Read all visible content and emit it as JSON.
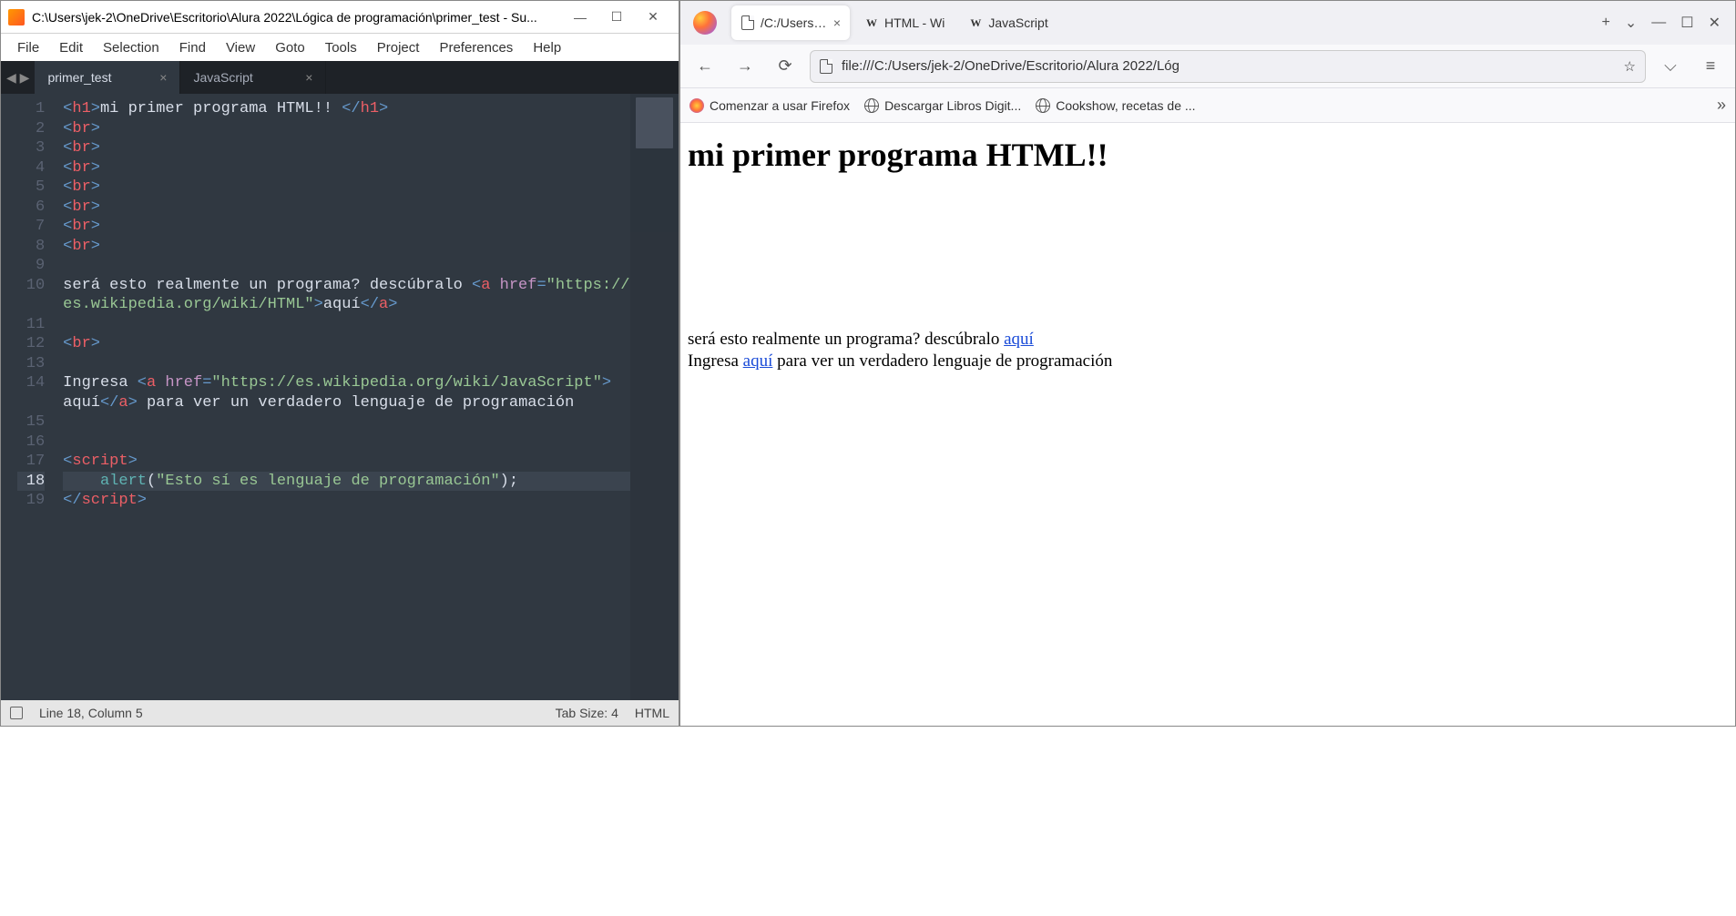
{
  "sublime": {
    "title": "C:\\Users\\jek-2\\OneDrive\\Escritorio\\Alura 2022\\Lógica de programación\\primer_test - Su...",
    "menu": [
      "File",
      "Edit",
      "Selection",
      "Find",
      "View",
      "Goto",
      "Tools",
      "Project",
      "Preferences",
      "Help"
    ],
    "tabs": [
      {
        "label": "primer_test",
        "active": true
      },
      {
        "label": "JavaScript",
        "active": false
      }
    ],
    "gutter": [
      "1",
      "2",
      "3",
      "4",
      "5",
      "6",
      "7",
      "8",
      "9",
      "10",
      "",
      "11",
      "12",
      "13",
      "14",
      "",
      "15",
      "16",
      "17",
      "18",
      "19"
    ],
    "code_lines": [
      {
        "hl": false,
        "segs": [
          {
            "c": "brkt",
            "t": "<"
          },
          {
            "c": "tag",
            "t": "h1"
          },
          {
            "c": "brkt",
            "t": ">"
          },
          {
            "c": "txt",
            "t": "mi primer programa HTML!! "
          },
          {
            "c": "brkt",
            "t": "</"
          },
          {
            "c": "tag",
            "t": "h1"
          },
          {
            "c": "brkt",
            "t": ">"
          }
        ]
      },
      {
        "hl": false,
        "segs": [
          {
            "c": "brkt",
            "t": "<"
          },
          {
            "c": "tag",
            "t": "br"
          },
          {
            "c": "brkt",
            "t": ">"
          }
        ]
      },
      {
        "hl": false,
        "segs": [
          {
            "c": "brkt",
            "t": "<"
          },
          {
            "c": "tag",
            "t": "br"
          },
          {
            "c": "brkt",
            "t": ">"
          }
        ]
      },
      {
        "hl": false,
        "segs": [
          {
            "c": "brkt",
            "t": "<"
          },
          {
            "c": "tag",
            "t": "br"
          },
          {
            "c": "brkt",
            "t": ">"
          }
        ]
      },
      {
        "hl": false,
        "segs": [
          {
            "c": "brkt",
            "t": "<"
          },
          {
            "c": "tag",
            "t": "br"
          },
          {
            "c": "brkt",
            "t": ">"
          }
        ]
      },
      {
        "hl": false,
        "segs": [
          {
            "c": "brkt",
            "t": "<"
          },
          {
            "c": "tag",
            "t": "br"
          },
          {
            "c": "brkt",
            "t": ">"
          }
        ]
      },
      {
        "hl": false,
        "segs": [
          {
            "c": "brkt",
            "t": "<"
          },
          {
            "c": "tag",
            "t": "br"
          },
          {
            "c": "brkt",
            "t": ">"
          }
        ]
      },
      {
        "hl": false,
        "segs": [
          {
            "c": "brkt",
            "t": "<"
          },
          {
            "c": "tag",
            "t": "br"
          },
          {
            "c": "brkt",
            "t": ">"
          }
        ]
      },
      {
        "hl": false,
        "segs": []
      },
      {
        "hl": false,
        "segs": [
          {
            "c": "txt",
            "t": "será esto realmente un programa? descúbralo "
          },
          {
            "c": "brkt",
            "t": "<"
          },
          {
            "c": "tag",
            "t": "a"
          },
          {
            "c": "txt",
            "t": " "
          },
          {
            "c": "attr",
            "t": "href"
          },
          {
            "c": "brkt",
            "t": "="
          },
          {
            "c": "str",
            "t": "\"https://"
          }
        ]
      },
      {
        "hl": false,
        "segs": [
          {
            "c": "str",
            "t": "es.wikipedia.org/wiki/HTML\""
          },
          {
            "c": "brkt",
            "t": ">"
          },
          {
            "c": "txt",
            "t": "aquí"
          },
          {
            "c": "brkt",
            "t": "</"
          },
          {
            "c": "tag",
            "t": "a"
          },
          {
            "c": "brkt",
            "t": ">"
          }
        ]
      },
      {
        "hl": false,
        "segs": []
      },
      {
        "hl": false,
        "segs": [
          {
            "c": "brkt",
            "t": "<"
          },
          {
            "c": "tag",
            "t": "br"
          },
          {
            "c": "brkt",
            "t": ">"
          }
        ]
      },
      {
        "hl": false,
        "segs": []
      },
      {
        "hl": false,
        "segs": [
          {
            "c": "txt",
            "t": "Ingresa "
          },
          {
            "c": "brkt",
            "t": "<"
          },
          {
            "c": "tag",
            "t": "a"
          },
          {
            "c": "txt",
            "t": " "
          },
          {
            "c": "attr",
            "t": "href"
          },
          {
            "c": "brkt",
            "t": "="
          },
          {
            "c": "str",
            "t": "\"https://es.wikipedia.org/wiki/JavaScript\""
          },
          {
            "c": "brkt",
            "t": ">"
          }
        ]
      },
      {
        "hl": false,
        "segs": [
          {
            "c": "txt",
            "t": "aquí"
          },
          {
            "c": "brkt",
            "t": "</"
          },
          {
            "c": "tag",
            "t": "a"
          },
          {
            "c": "brkt",
            "t": ">"
          },
          {
            "c": "txt",
            "t": " para ver un verdadero lenguaje de programación"
          }
        ]
      },
      {
        "hl": false,
        "segs": []
      },
      {
        "hl": false,
        "segs": []
      },
      {
        "hl": false,
        "segs": [
          {
            "c": "brkt",
            "t": "<"
          },
          {
            "c": "tag",
            "t": "script"
          },
          {
            "c": "brkt",
            "t": ">"
          }
        ]
      },
      {
        "hl": true,
        "segs": [
          {
            "c": "txt",
            "t": "    "
          },
          {
            "c": "func",
            "t": "alert"
          },
          {
            "c": "txt",
            "t": "("
          },
          {
            "c": "str",
            "t": "\"Esto sí es lenguaje de programación\""
          },
          {
            "c": "txt",
            "t": ");"
          }
        ]
      },
      {
        "hl": false,
        "segs": [
          {
            "c": "brkt",
            "t": "</"
          },
          {
            "c": "tag",
            "t": "script"
          },
          {
            "c": "brkt",
            "t": ">"
          }
        ]
      }
    ],
    "status": {
      "pos": "Line 18, Column 5",
      "tab": "Tab Size: 4",
      "lang": "HTML"
    }
  },
  "firefox": {
    "tabs": [
      {
        "label": "/C:/Users/jek",
        "active": true,
        "icon": "doc"
      },
      {
        "label": "HTML - Wi",
        "active": false,
        "icon": "wiki"
      },
      {
        "label": "JavaScript",
        "active": false,
        "icon": "wiki"
      }
    ],
    "url": "file:///C:/Users/jek-2/OneDrive/Escritorio/Alura 2022/Lóg",
    "bookmarks": [
      {
        "label": "Comenzar a usar Firefox",
        "icon": "ff"
      },
      {
        "label": "Descargar Libros Digit...",
        "icon": "globe"
      },
      {
        "label": "Cookshow, recetas de ...",
        "icon": "globe"
      }
    ],
    "page": {
      "h1": "mi primer programa HTML!!",
      "p1_pre": "será esto realmente un programa? descúbralo ",
      "p1_link": "aquí",
      "p2_pre": "Ingresa ",
      "p2_link": "aquí",
      "p2_post": " para ver un verdadero lenguaje de programación"
    }
  }
}
